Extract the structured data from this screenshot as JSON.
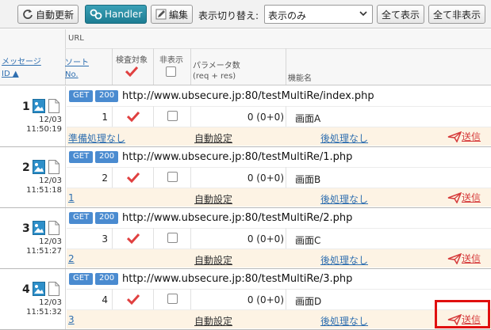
{
  "toolbar": {
    "refresh_label": "自動更新",
    "handler_label": "Handler",
    "edit_label": "編集",
    "toggle_label": "表示切り替え:",
    "select_value": "表示のみ",
    "show_all_label": "全て表示",
    "hide_all_label": "全て非表示"
  },
  "header": {
    "url": "URL",
    "message": "メッセージ",
    "id_sort": "ID ▲",
    "sort_line1": "ソート",
    "sort_line2": "No.",
    "check_target": "検査対象",
    "hidden": "非表示",
    "params_line1": "パラメータ数",
    "params_line2": "(req + res)",
    "function_name": "機能名"
  },
  "colors": {
    "accent": "#4a8bd0",
    "check": "#e04040",
    "send": "#d63b3b",
    "row_bg": "#fdf3e4",
    "highlight": "#e01010"
  },
  "records": [
    {
      "id": "1",
      "date": "12/03",
      "time": "11:50:19",
      "method": "GET",
      "status": "200",
      "url": "http://www.ubsecure.jp:80/testMultiRe/index.php",
      "sort_no": "1",
      "params": "0 (0+0)",
      "function": "画面A",
      "pre": "準備処理なし",
      "setting": "自動設定",
      "post": "後処理なし",
      "send": "送信"
    },
    {
      "id": "2",
      "date": "12/03",
      "time": "11:51:18",
      "method": "GET",
      "status": "200",
      "url": "http://www.ubsecure.jp:80/testMultiRe/1.php",
      "sort_no": "2",
      "params": "0 (0+0)",
      "function": "画面B",
      "pre": "1",
      "setting": "自動設定",
      "post": "後処理なし",
      "send": "送信"
    },
    {
      "id": "3",
      "date": "12/03",
      "time": "11:51:27",
      "method": "GET",
      "status": "200",
      "url": "http://www.ubsecure.jp:80/testMultiRe/2.php",
      "sort_no": "3",
      "params": "0 (0+0)",
      "function": "画面C",
      "pre": "2",
      "setting": "自動設定",
      "post": "後処理なし",
      "send": "送信"
    },
    {
      "id": "4",
      "date": "12/03",
      "time": "11:51:32",
      "method": "GET",
      "status": "200",
      "url": "http://www.ubsecure.jp:80/testMultiRe/3.php",
      "sort_no": "4",
      "params": "0 (0+0)",
      "function": "画面D",
      "pre": "3",
      "setting": "自動設定",
      "post": "後処理なし",
      "send": "送信"
    }
  ]
}
